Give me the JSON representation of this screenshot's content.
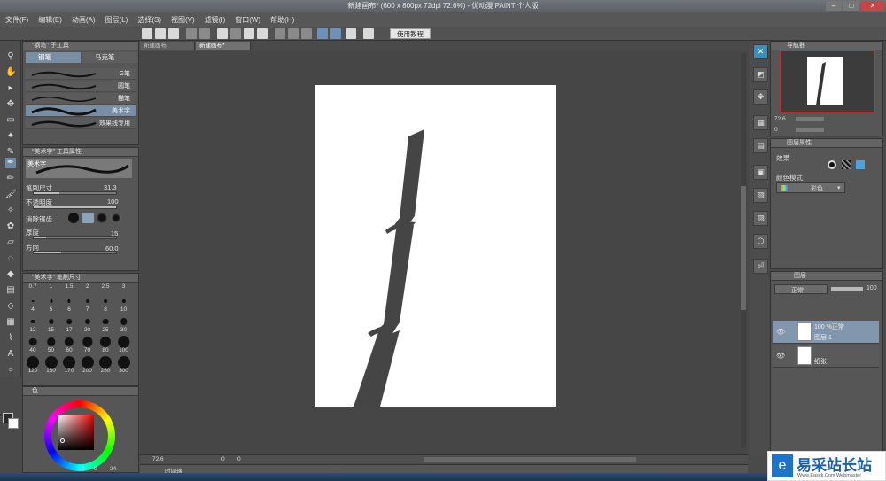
{
  "window": {
    "title": "新建画布* (600 x 800px 72dpi 72.6%) - 优动漫 PAINT 个人版"
  },
  "menu": [
    "文件(F)",
    "编辑(E)",
    "动画(A)",
    "图层(L)",
    "选择(S)",
    "视图(V)",
    "滤镜(I)",
    "窗口(W)",
    "帮助(H)"
  ],
  "toolbar": {
    "tutorial_label": "使用教程"
  },
  "subtool_panel": {
    "title": "\"钢笔\" 子工具",
    "tabs": [
      "钢笔",
      "马克笔"
    ],
    "brushes": [
      "G笔",
      "圆笔",
      "描笔",
      "美术字",
      "效果线专用"
    ],
    "selected_brush": "美术字"
  },
  "tool_property": {
    "title": "\"美术字\" 工具属性",
    "preview_label": "美术字",
    "params": [
      {
        "label": "笔刷尺寸",
        "value": "31.3",
        "level": 0.31
      },
      {
        "label": "不透明度",
        "value": "100",
        "level": 1.0
      },
      {
        "label": "消除锯齿",
        "value": "",
        "level": 0
      },
      {
        "label": "厚度",
        "value": "15",
        "level": 0.15
      },
      {
        "label": "方向",
        "value": "60.0",
        "level": 0.33
      }
    ]
  },
  "brush_size_panel": {
    "title": "\"美术字\" 笔刷尺寸",
    "header_values": [
      "0.7",
      "1",
      "1.5",
      "2",
      "2.5",
      "3"
    ],
    "sizes": [
      "4",
      "5",
      "6",
      "7",
      "8",
      "10",
      "12",
      "15",
      "17",
      "20",
      "25",
      "30",
      "40",
      "50",
      "60",
      "70",
      "80",
      "100",
      "120",
      "150",
      "170",
      "200",
      "250",
      "300"
    ]
  },
  "color_panel": {
    "tab_label": "色",
    "wheel_values": [
      "0",
      "0",
      "24"
    ]
  },
  "document": {
    "tabs": [
      "新建画布",
      "新建画布*"
    ]
  },
  "navigator": {
    "title": "导航器",
    "zoom": "72.6",
    "angle": "0"
  },
  "layer_property": {
    "title": "图层属性",
    "effect_label": "效果",
    "color_mode_label": "颜色模式",
    "color_mode_value": "彩色"
  },
  "layers_panel": {
    "title": "图层",
    "blend_mode": "正常",
    "opacity": "100",
    "layers": [
      {
        "info": "100 %正常",
        "name": "图层 1"
      },
      {
        "info": "",
        "name": "纸张"
      }
    ]
  },
  "timeline": {
    "label": "时间轴"
  },
  "statusbar": {
    "zoom": "72.6",
    "value2": "0",
    "value3": "0"
  },
  "watermark": {
    "text": "易采站长站",
    "subtext": "Www.Easck.Com Webmaster"
  }
}
